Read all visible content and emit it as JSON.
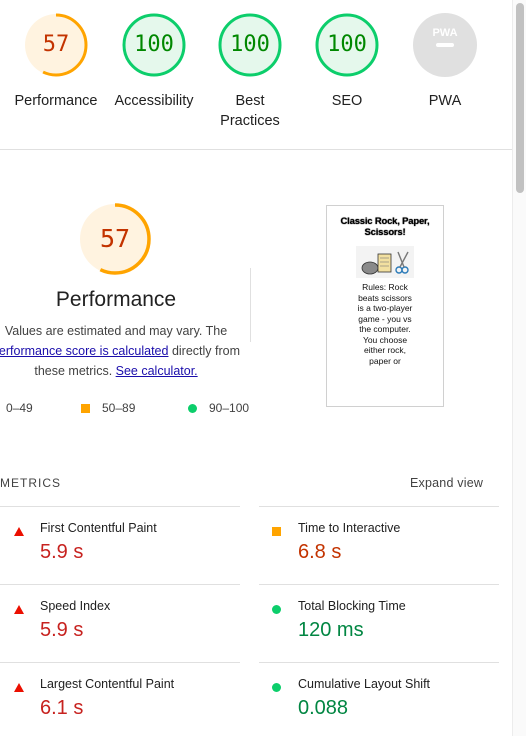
{
  "gauges": [
    {
      "name": "performance",
      "score": "57",
      "label": "Performance",
      "fraction": 0.57,
      "color": "#ffa400",
      "text_color": "#c33300",
      "bg": "#fff3e0"
    },
    {
      "name": "accessibility",
      "score": "100",
      "label": "Accessibility",
      "fraction": 1.0,
      "color": "#0cce6b",
      "text_color": "#008800",
      "bg": "#e5f8ec"
    },
    {
      "name": "best-practices",
      "score": "100",
      "label": "Best Practices",
      "fraction": 1.0,
      "color": "#0cce6b",
      "text_color": "#008800",
      "bg": "#e5f8ec"
    },
    {
      "name": "seo",
      "score": "100",
      "label": "SEO",
      "fraction": 1.0,
      "color": "#0cce6b",
      "text_color": "#008800",
      "bg": "#e5f8ec"
    },
    {
      "name": "pwa",
      "score": "",
      "label": "PWA",
      "fraction": 0,
      "color": "#e0e0e0",
      "text_color": "#9e9e9e",
      "bg": "#e0e0e0"
    }
  ],
  "pwa_badge": {
    "text": "PWA",
    "icon": "pwa-badge-icon"
  },
  "performance": {
    "score": "57",
    "fraction": 0.57,
    "title": "Performance",
    "desc_line1": "Values are estimated and may vary. The",
    "desc_link1": "performance score is calculated",
    "desc_line2_suffix": " directly from",
    "desc_line3_prefix": "these metrics. ",
    "desc_link2": "See calculator."
  },
  "legend": {
    "fail": "0–49",
    "average": "50–89",
    "pass": "90–100"
  },
  "thumbnail": {
    "title": "Classic Rock, Paper, Scissors!",
    "body": "Rules: Rock beats scissors is a two-player game - you vs the computer. You choose either rock, paper or"
  },
  "metrics_section": {
    "header": "METRICS",
    "expand_label": "Expand view"
  },
  "metrics": [
    {
      "title": "First Contentful Paint",
      "value": "5.9 s",
      "rating": "fail"
    },
    {
      "title": "Time to Interactive",
      "value": "6.8 s",
      "rating": "average"
    },
    {
      "title": "Speed Index",
      "value": "5.9 s",
      "rating": "fail"
    },
    {
      "title": "Total Blocking Time",
      "value": "120 ms",
      "rating": "pass"
    },
    {
      "title": "Largest Contentful Paint",
      "value": "6.1 s",
      "rating": "fail"
    },
    {
      "title": "Cumulative Layout Shift",
      "value": "0.088",
      "rating": "pass"
    }
  ],
  "colors": {
    "fail": "#eb0f00",
    "average": "#ffa400",
    "pass": "#0cce6b",
    "link": "#1a0dab"
  }
}
